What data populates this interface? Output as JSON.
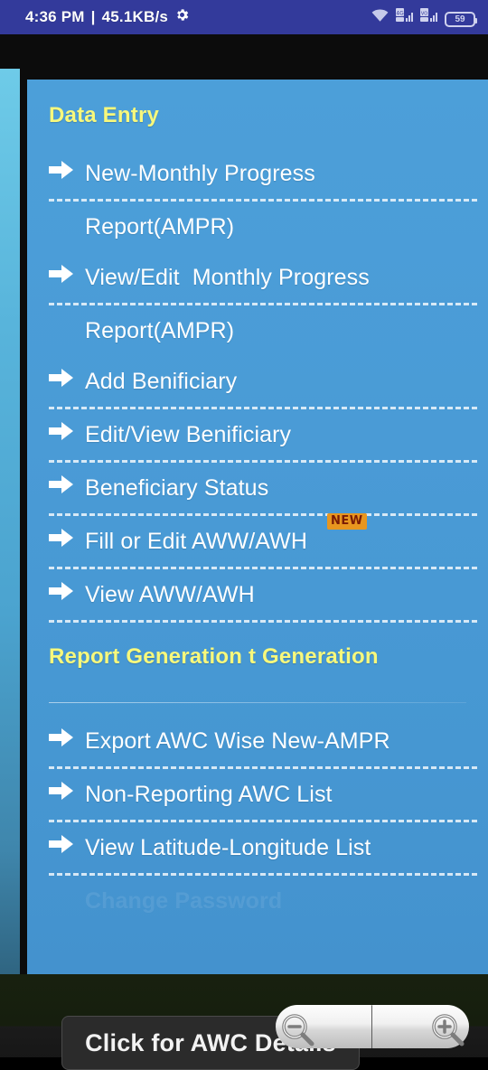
{
  "status_bar": {
    "time": "4:36 PM",
    "separator": "|",
    "network_speed": "45.1KB/s",
    "gear_icon": "gear-icon",
    "wifi_icon": "wifi-icon",
    "sim1_icon": "sim1-signal-4g-icon",
    "sim2_icon": "sim2-signal-volte-icon",
    "battery_level": "59",
    "background_color": "#333a9b"
  },
  "drawer": {
    "background_color": "#4a9bd6",
    "heading_color": "#f7f87c",
    "sections": [
      {
        "id": "data-entry",
        "title": "Data Entry",
        "items": [
          {
            "label": "New-Monthly Progress",
            "label_line2": "Report(AMPR)",
            "badge": null
          },
          {
            "label": "View/Edit  Monthly Progress",
            "label_line2": "Report(AMPR)",
            "badge": null
          },
          {
            "label": "Add Benificiary",
            "label_line2": null,
            "badge": null
          },
          {
            "label": "Edit/View Benificiary",
            "label_line2": null,
            "badge": null
          },
          {
            "label": "Beneficiary Status",
            "label_line2": null,
            "badge": null
          },
          {
            "label": "Fill or Edit AWW/AWH",
            "label_line2": null,
            "badge": "NEW"
          },
          {
            "label": "View AWW/AWH",
            "label_line2": null,
            "badge": null
          }
        ]
      },
      {
        "id": "report-generation",
        "title": "Report Generation t Generation",
        "items": [
          {
            "label": "Export AWC Wise New-AMPR",
            "label_line2": null,
            "badge": null
          },
          {
            "label": "Non-Reporting AWC List",
            "label_line2": null,
            "badge": null
          },
          {
            "label": "View Latitude-Longitude List",
            "label_line2": null,
            "badge": null
          },
          {
            "label": "Change Password",
            "label_line2": null,
            "badge": null
          }
        ]
      }
    ],
    "badge_new": {
      "text": "NEW",
      "background_color": "#e8961f",
      "text_color": "#7a1c05"
    },
    "arrow_icon": "arrow-right-icon"
  },
  "map": {
    "popup_label": "Click for AWC Details",
    "zoom_out_icon": "zoom-out-magnifier-icon",
    "zoom_in_icon": "zoom-in-magnifier-icon"
  }
}
